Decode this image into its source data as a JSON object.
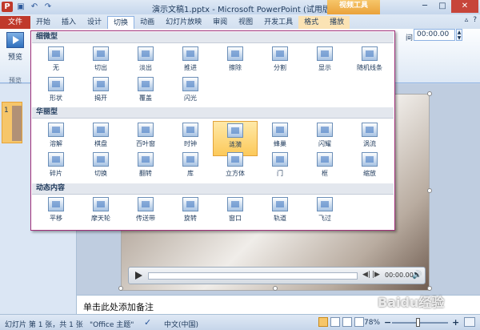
{
  "window": {
    "title": "演示文稿1.pptx - Microsoft PowerPoint (试用版)",
    "context_group": "视频工具"
  },
  "qat": {
    "app_icon": "P",
    "save_icon": "save-icon",
    "undo_icon": "undo-icon",
    "redo_icon": "redo-icon"
  },
  "win_controls": {
    "minimize": "─",
    "maximize": "□",
    "close": "✕"
  },
  "tabs": [
    "文件",
    "开始",
    "插入",
    "设计",
    "切换",
    "动画",
    "幻灯片放映",
    "审阅",
    "视图",
    "开发工具",
    "格式",
    "播放"
  ],
  "tab_active_index": 4,
  "tabs_right": {
    "help_icon": "?",
    "minimize_ribbon": "▵"
  },
  "ribbon": {
    "preview_label": "预览",
    "preview_group_label": "预览",
    "duration_label": "间：",
    "duration_value": "00:00.00",
    "spin_up": "▲",
    "spin_down": "▼"
  },
  "gallery": {
    "sections": [
      {
        "title": "细微型",
        "items": [
          "无",
          "切出",
          "淡出",
          "推进",
          "擦除",
          "分割",
          "显示",
          "随机线条",
          "形状",
          "揭开",
          "覆盖",
          "闪光"
        ]
      },
      {
        "title": "华丽型",
        "items": [
          "溶解",
          "棋盘",
          "百叶窗",
          "时钟",
          "涟漪",
          "蜂巢",
          "闪耀",
          "涡流",
          "碎片",
          "切换",
          "翻转",
          "库",
          "立方体",
          "门",
          "框",
          "缩放"
        ],
        "selected_index": 4
      },
      {
        "title": "动态内容",
        "items": [
          "平移",
          "摩天轮",
          "传送带",
          "旋转",
          "窗口",
          "轨道",
          "飞过"
        ]
      }
    ]
  },
  "slides_pane": {
    "slide_number": "1"
  },
  "player": {
    "time": "00:00.00",
    "prev": "◀|",
    "next": "|▶",
    "volume_icon": "volume-icon"
  },
  "notes": {
    "placeholder": "单击此处添加备注"
  },
  "status": {
    "slide_info": "幻灯片 第 1 张，共 1 张",
    "theme": "\"Office 主题\"",
    "language": "中文(中国)",
    "zoom": "78%",
    "zoom_minus": "−",
    "zoom_plus": "+"
  },
  "watermark": "Baidu经验"
}
